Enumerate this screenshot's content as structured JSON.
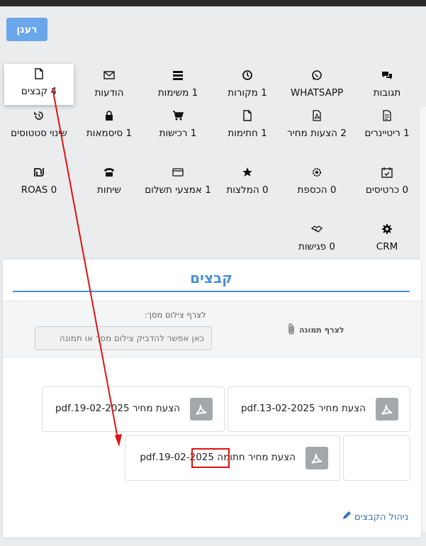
{
  "refresh_label": "רענן",
  "tiles": [
    {
      "id": "tags",
      "label": "תגובות",
      "icon": "chat-bubbles-icon"
    },
    {
      "id": "whatsapp",
      "label": "WHATSAPP",
      "icon": "whatsapp-icon"
    },
    {
      "id": "sources",
      "label": "1 מקורות",
      "icon": "clock-icon"
    },
    {
      "id": "tasks",
      "label": "1 משימות",
      "icon": "list-icon"
    },
    {
      "id": "messages",
      "label": "הודעות",
      "icon": "envelope-icon"
    },
    {
      "id": "files",
      "label": "4 קבצים",
      "icon": "file-icon",
      "active": true
    },
    {
      "id": "retainers",
      "label": "1 ריטיינרים",
      "icon": "invoice-icon"
    },
    {
      "id": "quotes",
      "label": "2 הצעות מחיר",
      "icon": "pdf-icon"
    },
    {
      "id": "signatures",
      "label": "1 חתימות",
      "icon": "file-icon"
    },
    {
      "id": "purchases",
      "label": "1 רכישות",
      "icon": "cart-icon"
    },
    {
      "id": "passwords",
      "label": "1 סיסמאות",
      "icon": "lock-icon"
    },
    {
      "id": "status_changes",
      "label": "שינוי סטטוסים",
      "icon": "history-icon"
    },
    {
      "id": "cards",
      "label": "0 כרטיסים",
      "icon": "calendar-check-icon"
    },
    {
      "id": "silver",
      "label": "0 הכספת",
      "icon": "cog-badge-icon"
    },
    {
      "id": "recommendations",
      "label": "0 המלצות",
      "icon": "star-icon"
    },
    {
      "id": "payment_methods",
      "label": "1 אמצעי תשלום",
      "icon": "credit-card-icon"
    },
    {
      "id": "calls",
      "label": "שיחות",
      "icon": "phone-icon"
    },
    {
      "id": "roas",
      "label": "0 ROAS",
      "icon": "shekel-icon"
    },
    {
      "id": "crm",
      "label": "CRM",
      "icon": "gear-icon"
    },
    {
      "id": "meetings",
      "label": "0 פגישות",
      "icon": "handshake-icon"
    }
  ],
  "panel": {
    "title": "קבצים",
    "attach_image_label": "לצרף תמונה",
    "paste_label": "לצרף צילום מסך:",
    "paste_placeholder": "כאן אפשר להדביק צילום מסך או תמונה",
    "files": [
      {
        "name": "הצעת מחיר 13-02-2025.pdf"
      },
      {
        "name": "הצעת מחיר 19-02-2025.pdf"
      },
      {
        "name": "הצעת מחיר חתומה 19-02-2025.pdf"
      }
    ],
    "manage_label": "ניהול הקבצים"
  },
  "colors": {
    "accent": "#4a90d9",
    "button": "#6aa6ea",
    "annotation": "#e01212",
    "pdf_tile": "#a3a8ad"
  }
}
